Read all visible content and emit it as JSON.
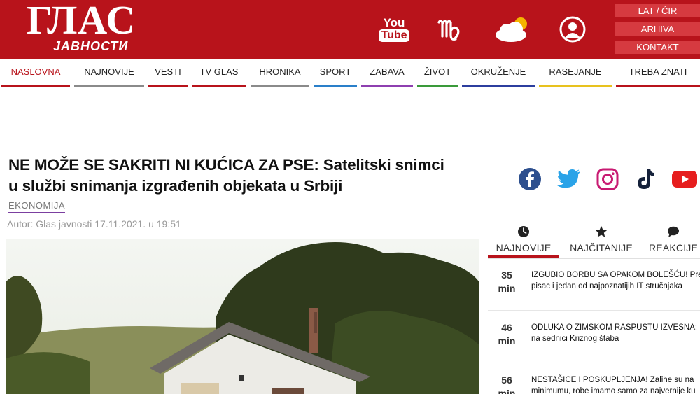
{
  "header": {
    "logo_main": "ГЛАС",
    "logo_sub": "ЈАВНОСТИ",
    "youtube_top": "You",
    "youtube_bottom": "Tube",
    "buttons": [
      "LAT / ĆIR",
      "ARHIVA",
      "KONTAKT"
    ],
    "accent_color": "#b8131b"
  },
  "nav": {
    "items": [
      {
        "label": "NASLOVNA",
        "color": "#b8131b"
      },
      {
        "label": "NAJNOVIJE",
        "color": "#8a8a8a"
      },
      {
        "label": "VESTI",
        "color": "#b8131b"
      },
      {
        "label": "TV GLAS",
        "color": "#b8131b"
      },
      {
        "label": "HRONIKA",
        "color": "#8a8a8a"
      },
      {
        "label": "SPORT",
        "color": "#2a7fc9"
      },
      {
        "label": "ZABAVA",
        "color": "#8e3fb0"
      },
      {
        "label": "ŽIVOT",
        "color": "#3a9a3a"
      },
      {
        "label": "OKRUŽENJE",
        "color": "#2c3e9e"
      },
      {
        "label": "RASEJANJE",
        "color": "#e8c21e"
      },
      {
        "label": "TREBA ZNATI",
        "color": "#b8131b"
      }
    ]
  },
  "article": {
    "title_line1": "NE MOŽE SE SAKRITI NI KUĆICA ZA PSE: Satelitski snimci",
    "title_line2": "u službi snimanja izgrađenih objekata u Srbiji",
    "category": "EKONOMIJA",
    "byline": "Autor: Glas javnosti 17.11.2021. u 19:51"
  },
  "social": [
    "facebook-icon",
    "twitter-icon",
    "instagram-icon",
    "tiktok-icon",
    "youtube-icon"
  ],
  "tabs": [
    {
      "label": "NAJNOVIJE",
      "icon": "clock-icon"
    },
    {
      "label": "NAJČITANIJE",
      "icon": "star-icon"
    },
    {
      "label": "REAKCIJE",
      "icon": "comment-icon"
    }
  ],
  "news": [
    {
      "num": "35",
      "unit": "min",
      "line1": "IZGUBIO BORBU SA OPAKOM BOLEŠĆU! Prem",
      "line2": "pisac i jedan od najpoznatijih IT stručnjaka"
    },
    {
      "num": "46",
      "unit": "min",
      "line1": "ODLUKA O ZIMSKOM RASPUSTU IZVESNA: P",
      "line2": "na sednici Kriznog štaba"
    },
    {
      "num": "56",
      "unit": "min",
      "line1": "NESTAŠICE I POSKUPLJENJA! Zalihe su na",
      "line2": "minimumu, robe imamo samo za najvernije ku"
    }
  ]
}
